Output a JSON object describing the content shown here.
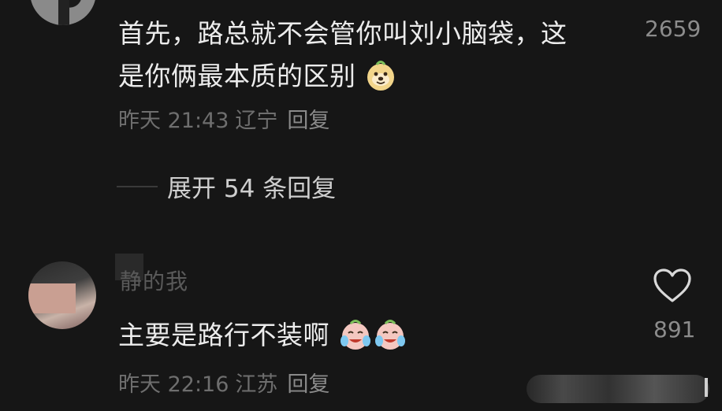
{
  "comment1": {
    "text_line1": "首先，路总就不会管你叫刘小脑袋，这",
    "text_line2": "是你俩最本质的区别",
    "time": "昨天 21:43",
    "location": "辽宁",
    "reply_label": "回复",
    "likes": "2659",
    "emoji": "doge-emoji"
  },
  "expand": {
    "label": "展开 54 条回复"
  },
  "comment2": {
    "username": "静的我",
    "text": "主要是路行不装啊",
    "time": "昨天 22:16",
    "location": "江苏",
    "reply_label": "回复",
    "likes": "891",
    "emoji": "cry-laugh-emoji"
  },
  "colors": {
    "background": "#161616",
    "text_primary": "#ececec",
    "text_secondary": "#6e6e6e",
    "like_count": "#8c8c8c"
  }
}
